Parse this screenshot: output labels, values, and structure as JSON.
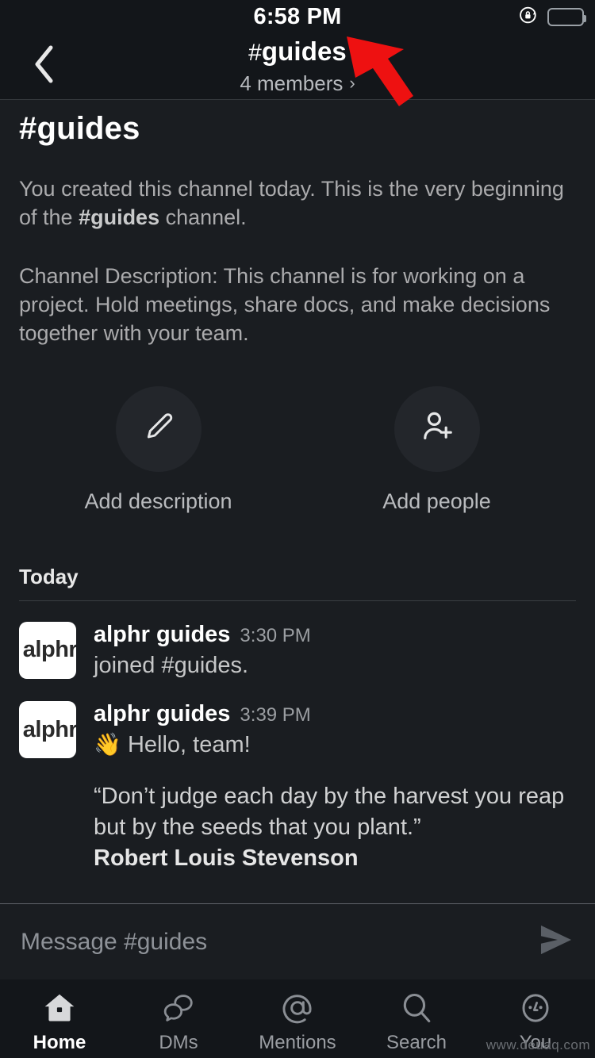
{
  "status_bar": {
    "time": "6:58 PM",
    "rotation_lock_icon": "rotation-lock-icon",
    "battery_icon": "battery-full-icon"
  },
  "header": {
    "back_icon": "chevron-left-icon",
    "hash": "#",
    "channel_name": "guides",
    "members_text": "4 members",
    "members_chevron": "›"
  },
  "intro": {
    "channel_heading": "#guides",
    "paragraph1_before": "You created this channel today. This is the very beginning of the ",
    "paragraph1_bold": "#guides",
    "paragraph1_after": " channel.",
    "paragraph2": "Channel Description: This channel is for working on a project. Hold meetings, share docs, and make decisions together with your team."
  },
  "actions": [
    {
      "icon": "pencil-icon",
      "label": "Add description"
    },
    {
      "icon": "add-person-icon",
      "label": "Add people"
    }
  ],
  "divider": {
    "today_label": "Today"
  },
  "messages": [
    {
      "avatar_text": "alphr",
      "user": "alphr guides",
      "time": "3:30 PM",
      "text": "joined #guides."
    },
    {
      "avatar_text": "alphr",
      "user": "alphr guides",
      "time": "3:39 PM",
      "emoji": "👋",
      "text": "Hello, team!",
      "quote_line1": "“Don’t judge each day by the harvest you reap",
      "quote_line2": "but by the seeds that you plant.”",
      "quote_author": "Robert Louis Stevenson"
    }
  ],
  "composer": {
    "placeholder": "Message #guides",
    "send_icon": "send-arrow-icon"
  },
  "bottom_nav": [
    {
      "icon": "home-icon",
      "label": "Home",
      "active": true
    },
    {
      "icon": "dms-icon",
      "label": "DMs",
      "active": false
    },
    {
      "icon": "mentions-icon",
      "label": "Mentions",
      "active": false
    },
    {
      "icon": "search-icon",
      "label": "Search",
      "active": false
    },
    {
      "icon": "you-icon",
      "label": "You",
      "active": false
    }
  ],
  "watermark": "www.deuaq.com",
  "annotation": {
    "arrow_color": "#ee1111",
    "points_at": "channel-title"
  },
  "colors": {
    "background": "#1a1d21",
    "chrome": "#13161a",
    "text_primary": "#ffffff",
    "text_secondary": "#ababad",
    "accent_red": "#ee1111"
  }
}
